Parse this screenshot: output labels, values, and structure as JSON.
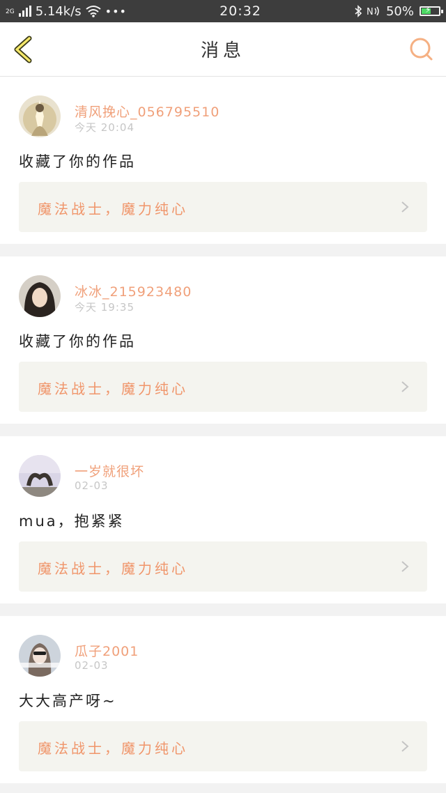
{
  "status_bar": {
    "network_gen": "2G",
    "speed": "5.14k/s",
    "dots": "•••",
    "time": "20:32",
    "battery": "50%",
    "icons": [
      "signal-icon",
      "wifi-icon",
      "bluetooth-icon",
      "nfc-icon",
      "battery-icon"
    ]
  },
  "nav": {
    "title": "消息",
    "accent": "#f5b083",
    "back_icon": "back-chevron-icon",
    "search_icon": "search-icon"
  },
  "messages": [
    {
      "user": "清风挽心_056795510",
      "time": "今天 20:04",
      "text": "收藏了你的作品",
      "work": "魔法战士，魔力纯心"
    },
    {
      "user": "冰冰_215923480",
      "time": "今天 19:35",
      "text": "收藏了你的作品",
      "work": "魔法战士，魔力纯心"
    },
    {
      "user": "一岁就很坏",
      "time": "02-03",
      "text": "mua，抱紧紧",
      "work": "魔法战士，魔力纯心"
    },
    {
      "user": "瓜子2001",
      "time": "02-03",
      "text": "大大高产呀~",
      "work": "魔法战士，魔力纯心"
    }
  ]
}
